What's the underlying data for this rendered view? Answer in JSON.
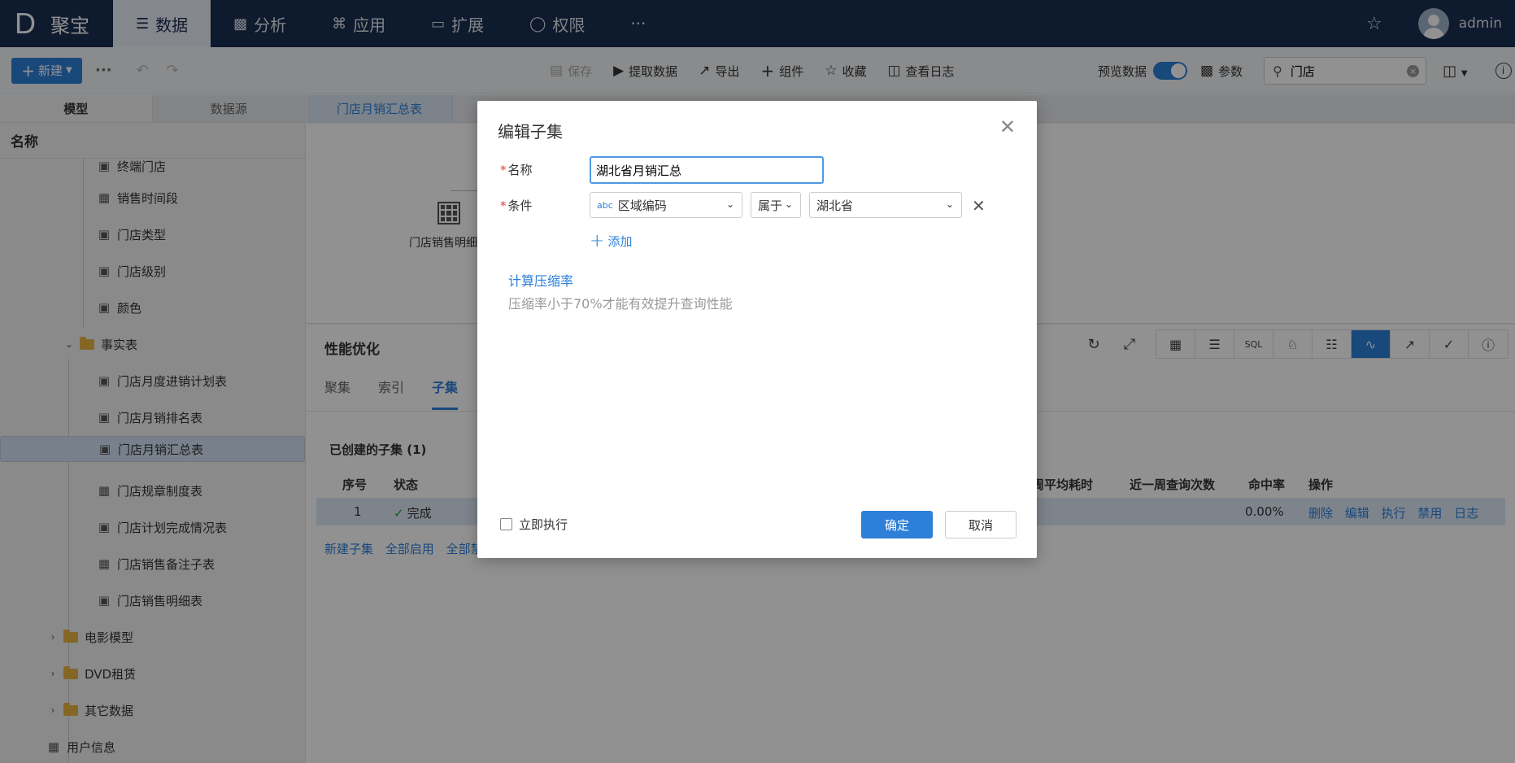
{
  "app": {
    "logo_letter": "D",
    "name": "聚宝"
  },
  "nav": [
    {
      "label": "数据",
      "icon": "database-icon",
      "active": true
    },
    {
      "label": "分析",
      "icon": "bar-chart-icon",
      "active": false
    },
    {
      "label": "应用",
      "icon": "apps-icon",
      "active": false
    },
    {
      "label": "扩展",
      "icon": "extension-icon",
      "active": false
    },
    {
      "label": "权限",
      "icon": "shield-icon",
      "active": false
    }
  ],
  "nav_more": "···",
  "user": {
    "name": "admin"
  },
  "toolbar": {
    "new_label": "新建",
    "more": "···",
    "save": "保存",
    "extract": "提取数据",
    "export": "导出",
    "component": "组件",
    "favorite": "收藏",
    "view_log": "查看日志",
    "preview_label": "预览数据",
    "params": "参数",
    "search_value": "门店"
  },
  "left": {
    "tabs": [
      "模型",
      "数据源"
    ],
    "header": "名称",
    "items": [
      {
        "label": "终端门店",
        "icon": "table-link-icon"
      },
      {
        "label": "销售时间段",
        "icon": "table-icon"
      },
      {
        "label": "门店类型",
        "icon": "table-link-icon"
      },
      {
        "label": "门店级别",
        "icon": "table-link-icon"
      },
      {
        "label": "颜色",
        "icon": "table-link-icon"
      },
      {
        "label": "事实表",
        "icon": "folder-icon"
      },
      {
        "label": "门店月度进销计划表",
        "icon": "table-link-icon"
      },
      {
        "label": "门店月销排名表",
        "icon": "table-link-icon"
      },
      {
        "label": "门店月销汇总表",
        "icon": "table-link-icon"
      },
      {
        "label": "门店规章制度表",
        "icon": "table-icon"
      },
      {
        "label": "门店计划完成情况表",
        "icon": "table-link-icon"
      },
      {
        "label": "门店销售备注子表",
        "icon": "table-icon"
      },
      {
        "label": "门店销售明细表",
        "icon": "table-link-icon"
      },
      {
        "label": "电影模型",
        "icon": "folder-icon"
      },
      {
        "label": "DVD租赁",
        "icon": "folder-icon"
      },
      {
        "label": "其它数据",
        "icon": "folder-icon"
      },
      {
        "label": "用户信息",
        "icon": "table-icon"
      }
    ]
  },
  "main": {
    "tab": "门店月销汇总表",
    "node_label": "门店销售明细表",
    "perf_title": "性能优化",
    "perf_tabs": [
      "聚集",
      "索引",
      "子集"
    ],
    "created_label": "已创建的子集 (1)",
    "columns": {
      "index": "序号",
      "status": "状态",
      "avg_time": "周平均耗时",
      "query_count": "近一周查询次数",
      "hit_rate": "命中率",
      "ops": "操作"
    },
    "row": {
      "index": "1",
      "status": "完成",
      "hit_rate": "0.00%",
      "ops": [
        "删除",
        "编辑",
        "执行",
        "禁用",
        "日志"
      ]
    },
    "links": [
      "新建子集",
      "全部启用",
      "全部禁"
    ]
  },
  "modal": {
    "title": "编辑子集",
    "name_label": "名称",
    "name_value": "湖北省月销汇总",
    "cond_label": "条件",
    "cond_field_type": "abc",
    "cond_field": "区域编码",
    "cond_op": "属于",
    "cond_value": "湖北省",
    "add_label": "添加",
    "calc_link": "计算压缩率",
    "calc_hint": "压缩率小于70%才能有效提升查询性能",
    "exec_label": "立即执行",
    "ok_label": "确定",
    "cancel_label": "取消"
  }
}
